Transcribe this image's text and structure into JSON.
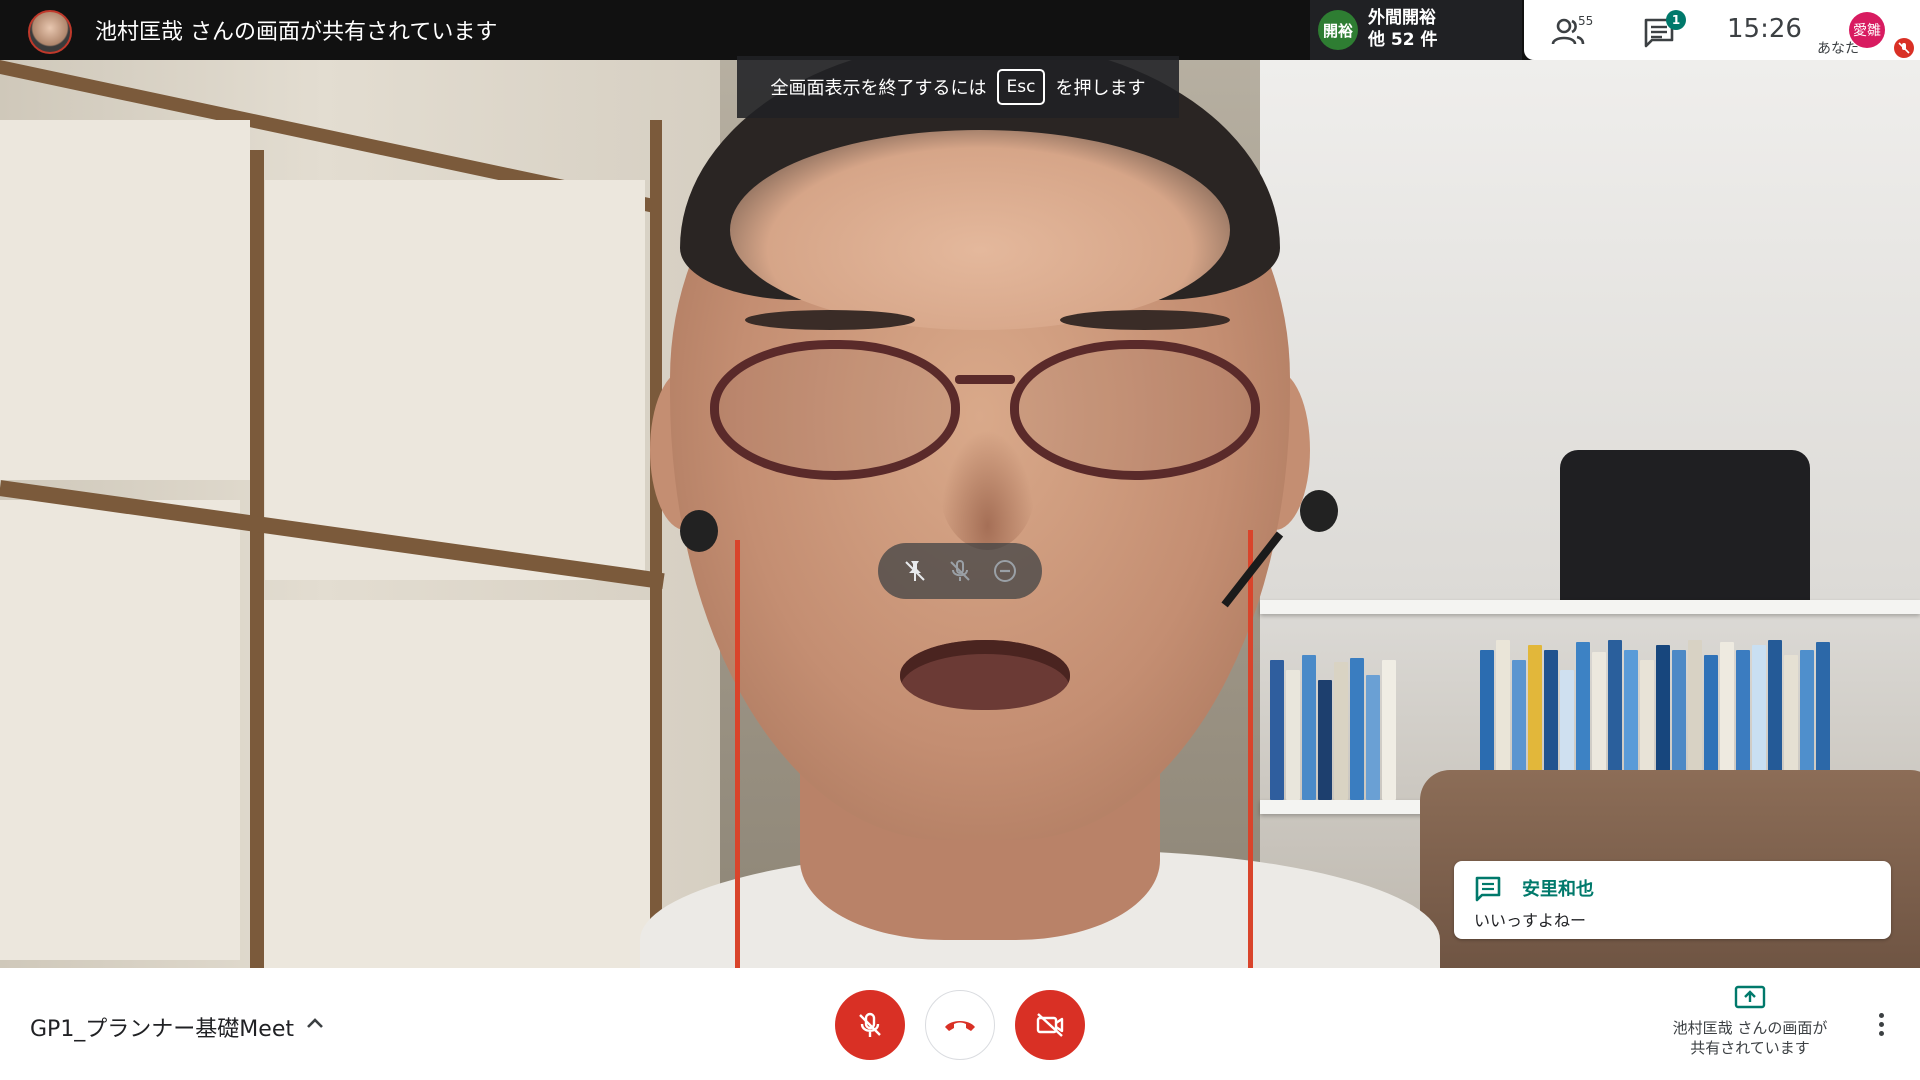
{
  "top_bar": {
    "presenter_banner": "池村匡哉 さんの画面が共有されています",
    "participant_chip": {
      "initials": "開裕",
      "name": "外間開裕",
      "others": "他 52 件"
    },
    "people_count": "55",
    "chat_unread": "1",
    "clock": "15:26",
    "self": {
      "initials": "愛雛",
      "label": "あなた"
    }
  },
  "toast": {
    "prefix": "全画面表示を終了するには",
    "key": "Esc",
    "suffix": "を押します"
  },
  "chat_notification": {
    "sender": "安里和也",
    "message": "いいっすよねー"
  },
  "bottom_bar": {
    "meeting_title": "GP1_プランナー基礎Meet",
    "presenting_line1": "池村匡哉 さんの画面が",
    "presenting_line2": "共有されています"
  },
  "colors": {
    "accent_red": "#d93025",
    "accent_green": "#00796b",
    "chip_green": "#2e7d32",
    "self_pink": "#d81b60"
  },
  "icons": [
    "people-icon",
    "chat-icon",
    "mic-off-icon",
    "hangup-icon",
    "camera-off-icon",
    "present-icon",
    "pin-icon",
    "minus-circle-icon",
    "more-vert-icon",
    "chevron-up-icon"
  ]
}
